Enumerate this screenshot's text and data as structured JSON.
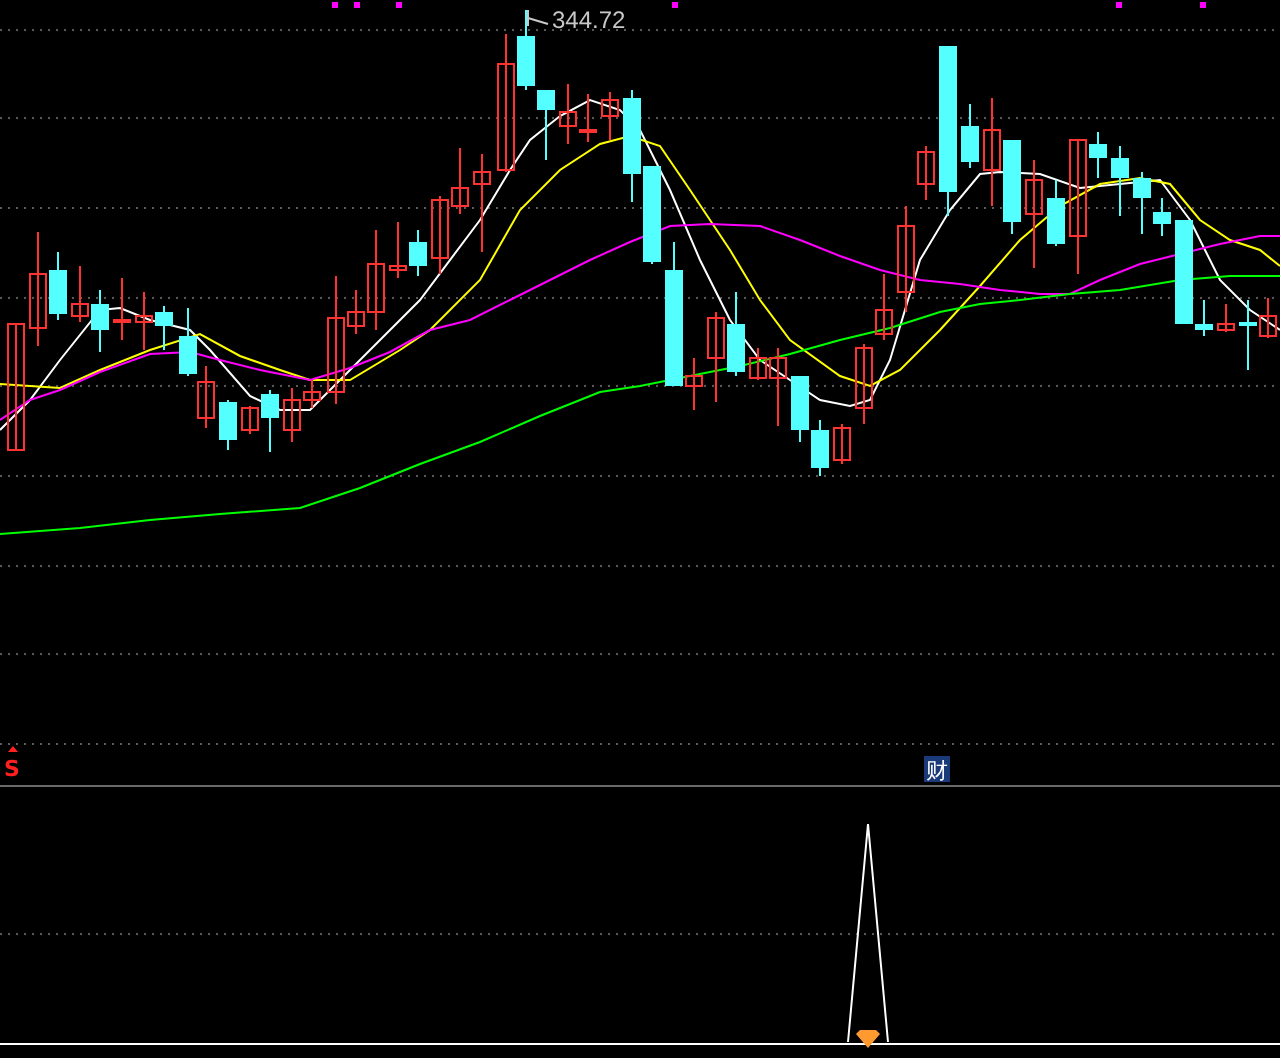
{
  "price_chart": {
    "high_label": "344.72"
  },
  "indicator_panel": {
    "signals": [
      {
        "kind": "marker",
        "label": "S"
      },
      {
        "kind": "badge",
        "label": "财"
      }
    ]
  }
}
